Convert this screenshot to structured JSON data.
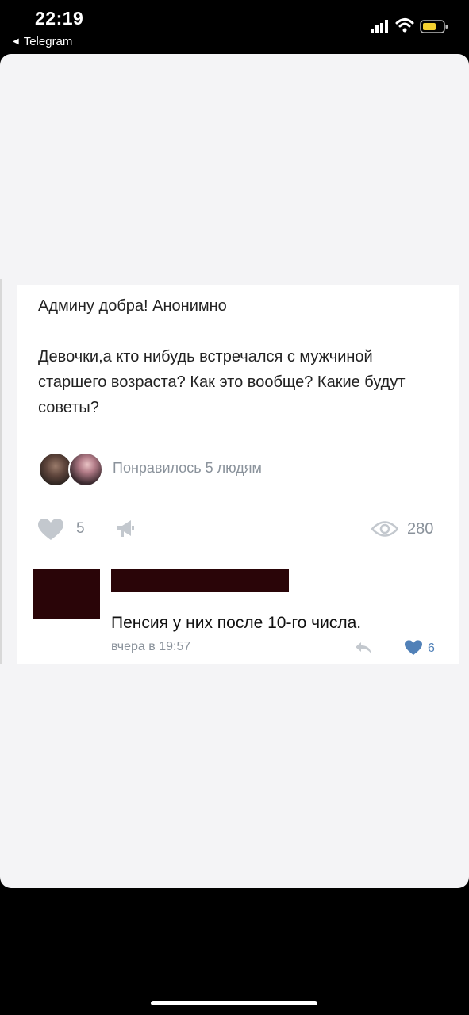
{
  "status_bar": {
    "time": "22:19",
    "back_label": "Telegram",
    "icons": [
      "signal-icon",
      "wifi-icon",
      "battery-icon"
    ],
    "battery_color": "#f5d130"
  },
  "post": {
    "header": "Админу добра! Анонимно",
    "body": "Девочки,а кто нибудь встречался с мужчиной старшего возраста? Как это вообще? Какие будут советы?",
    "likers_text": "Понравилось 5 людям",
    "likes": "5",
    "views": "280"
  },
  "comment": {
    "text": "Пенсия у них после 10-го числа.",
    "meta": "вчера в 19:57",
    "likes": "6",
    "redaction_color": "#2a0508"
  },
  "colors": {
    "accent_blue": "#5181b8",
    "muted": "#8a929b"
  }
}
